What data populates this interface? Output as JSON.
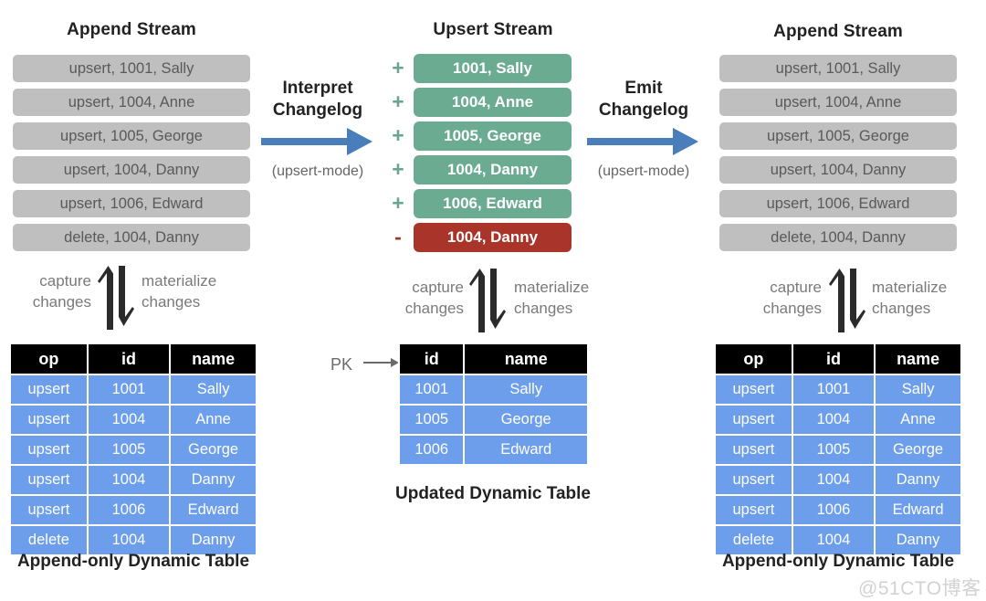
{
  "columns": {
    "left": {
      "stream_title": "Append Stream",
      "stream_rows": [
        "upsert, 1001, Sally",
        "upsert, 1004, Anne",
        "upsert, 1005, George",
        "upsert, 1004, Danny",
        "upsert, 1006, Edward",
        "delete, 1004, Danny"
      ],
      "capture_line1": "capture",
      "capture_line2": "changes",
      "materialize_line1": "materialize",
      "materialize_line2": "changes",
      "table": {
        "headers": [
          "op",
          "id",
          "name"
        ],
        "rows": [
          [
            "upsert",
            "1001",
            "Sally"
          ],
          [
            "upsert",
            "1004",
            "Anne"
          ],
          [
            "upsert",
            "1005",
            "George"
          ],
          [
            "upsert",
            "1004",
            "Danny"
          ],
          [
            "upsert",
            "1006",
            "Edward"
          ],
          [
            "delete",
            "1004",
            "Danny"
          ]
        ]
      },
      "caption": "Append-only Dynamic Table"
    },
    "middle": {
      "stream_title": "Upsert Stream",
      "stream_rows": [
        {
          "sign": "+",
          "kind": "add",
          "text": "1001, Sally"
        },
        {
          "sign": "+",
          "kind": "add",
          "text": "1004, Anne"
        },
        {
          "sign": "+",
          "kind": "add",
          "text": "1005, George"
        },
        {
          "sign": "+",
          "kind": "add",
          "text": "1004, Danny"
        },
        {
          "sign": "+",
          "kind": "add",
          "text": "1006, Edward"
        },
        {
          "sign": "-",
          "kind": "del",
          "text": "1004, Danny"
        }
      ],
      "capture_line1": "capture",
      "capture_line2": "changes",
      "materialize_line1": "materialize",
      "materialize_line2": "changes",
      "pk_label": "PK",
      "table": {
        "headers": [
          "id",
          "name"
        ],
        "rows": [
          [
            "1001",
            "Sally"
          ],
          [
            "1005",
            "George"
          ],
          [
            "1006",
            "Edward"
          ]
        ]
      },
      "caption": "Updated Dynamic Table"
    },
    "right": {
      "stream_title": "Append Stream",
      "stream_rows": [
        "upsert, 1001, Sally",
        "upsert, 1004, Anne",
        "upsert, 1005, George",
        "upsert, 1004, Danny",
        "upsert, 1006, Edward",
        "delete, 1004, Danny"
      ],
      "capture_line1": "capture",
      "capture_line2": "changes",
      "materialize_line1": "materialize",
      "materialize_line2": "changes",
      "table": {
        "headers": [
          "op",
          "id",
          "name"
        ],
        "rows": [
          [
            "upsert",
            "1001",
            "Sally"
          ],
          [
            "upsert",
            "1004",
            "Anne"
          ],
          [
            "upsert",
            "1005",
            "George"
          ],
          [
            "upsert",
            "1004",
            "Danny"
          ],
          [
            "upsert",
            "1006",
            "Edward"
          ],
          [
            "delete",
            "1004",
            "Danny"
          ]
        ]
      },
      "caption": "Append-only Dynamic Table"
    }
  },
  "flows": [
    {
      "title_line1": "Interpret",
      "title_line2": "Changelog",
      "subtitle": "(upsert-mode)"
    },
    {
      "title_line1": "Emit",
      "title_line2": "Changelog",
      "subtitle": "(upsert-mode)"
    }
  ],
  "watermark": "@51CTO博客",
  "colors": {
    "pill_bg": "#bfbfbf",
    "pill_text": "#595959",
    "upsert_add": "#6aab92",
    "upsert_del": "#a8342a",
    "table_cell": "#6d9eeb",
    "table_header": "#000000",
    "flow_arrow": "#4a7ebb"
  }
}
